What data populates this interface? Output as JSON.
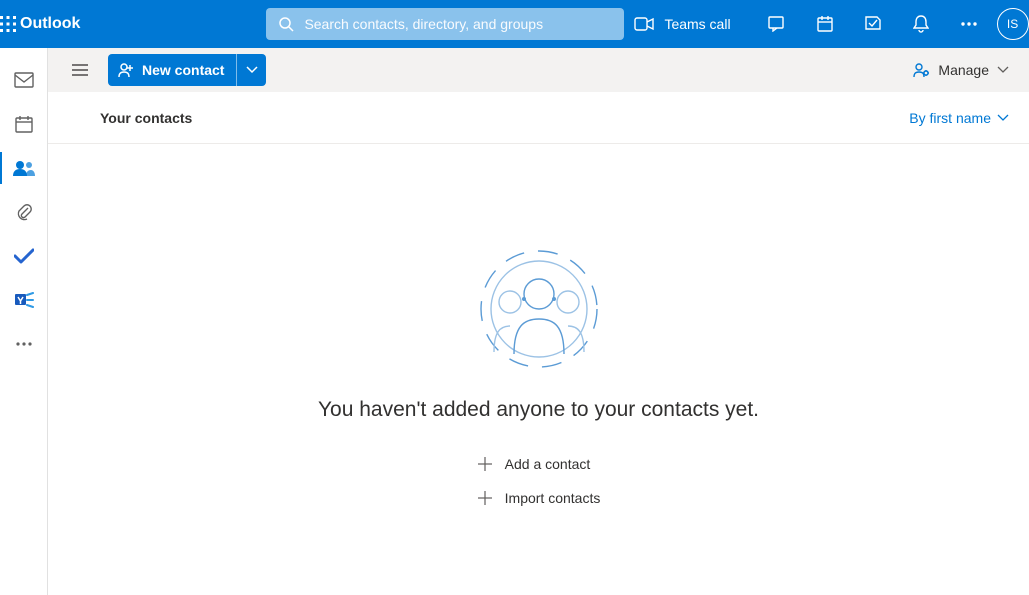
{
  "header": {
    "app_name": "Outlook",
    "search_placeholder": "Search contacts, directory, and groups",
    "teams_call_label": "Teams call",
    "avatar_initials": "IS"
  },
  "cmdbar": {
    "new_contact_label": "New contact",
    "manage_label": "Manage"
  },
  "subheader": {
    "title": "Your contacts",
    "sort_label": "By first name"
  },
  "empty": {
    "message": "You haven't added anyone to your contacts yet.",
    "add_label": "Add a contact",
    "import_label": "Import contacts"
  }
}
